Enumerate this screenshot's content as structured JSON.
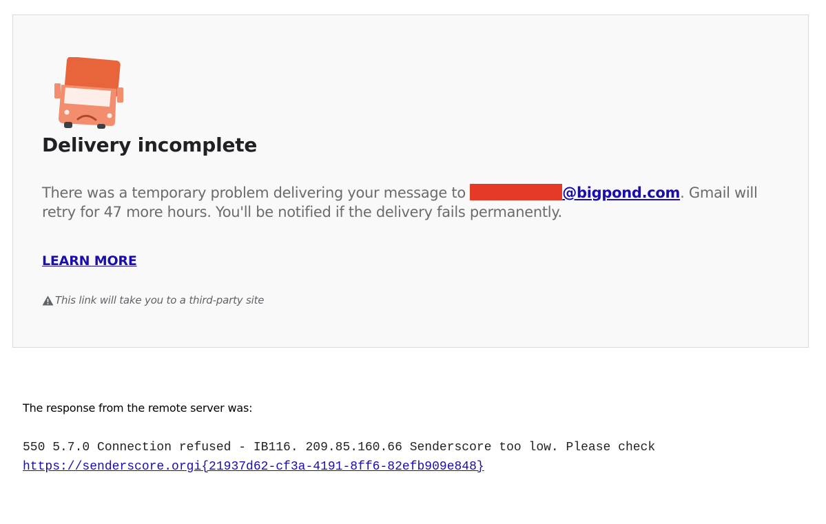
{
  "card": {
    "icon": "sad-delivery-truck-icon",
    "title": "Delivery incomplete",
    "message_before": "There was a temporary problem delivering your message to ",
    "recipient_domain": "@bigpond.com",
    "message_after_line1": ". Gmail will",
    "message_line2": "retry for 47 more hours. You'll be notified if the delivery fails permanently.",
    "learn_more": "LEARN MORE",
    "disclaimer_icon": "warning-icon",
    "disclaimer": "This link will take you to a third-party site"
  },
  "response": {
    "label": "The response from the remote server was:",
    "line1": "550 5.7.0 Connection refused - IB116. 209.85.160.66 Senderscore too low. Please check",
    "link": "https://senderscore.orgi{21937d62-cf3a-4191-8ff6-82efb909e848}"
  },
  "colors": {
    "card_background": "#f9f9f9",
    "card_border": "#dadada",
    "link": "#1a0dab",
    "redaction": "#e53a25",
    "truck_cab": "#e8643a",
    "truck_body": "#f28d6e"
  }
}
